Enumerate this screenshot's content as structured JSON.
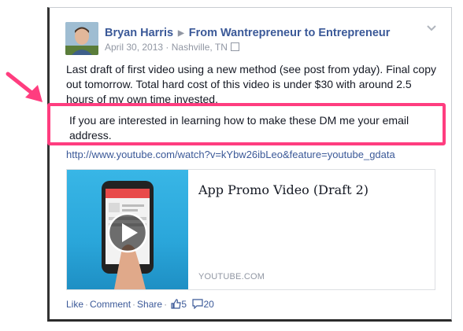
{
  "post": {
    "author": "Bryan Harris",
    "group": "From Wantrepreneur to Entrepreneur",
    "date": "April 30, 2013",
    "location": "Nashville, TN",
    "text": "Last draft of first video using a new method (see post from yday). Final copy out tomorrow. Total hard cost of this video is under $30 with around 2.5 hours of my own time invested.",
    "highlighted_text": "If you are interested in learning how to make these DM me your email address.",
    "link": "http://www.youtube.com/watch?v=kYbw26ibLeo&feature=youtube_gdata"
  },
  "share": {
    "title": "App Promo Video (Draft 2)",
    "source": "YOUTUBE.COM"
  },
  "actions": {
    "like": "Like",
    "comment": "Comment",
    "share": "Share",
    "like_count": "5",
    "comment_count": "20"
  },
  "colors": {
    "link_blue": "#3b5998",
    "meta_gray": "#9197a3",
    "highlight_pink": "#ff3d7f",
    "video_blue": "#2aa6da"
  },
  "icons": [
    "chevron-down-icon",
    "calendar-icon",
    "pointer-arrow-icon",
    "play-icon",
    "thumbs-up-icon",
    "comment-bubble-icon"
  ]
}
